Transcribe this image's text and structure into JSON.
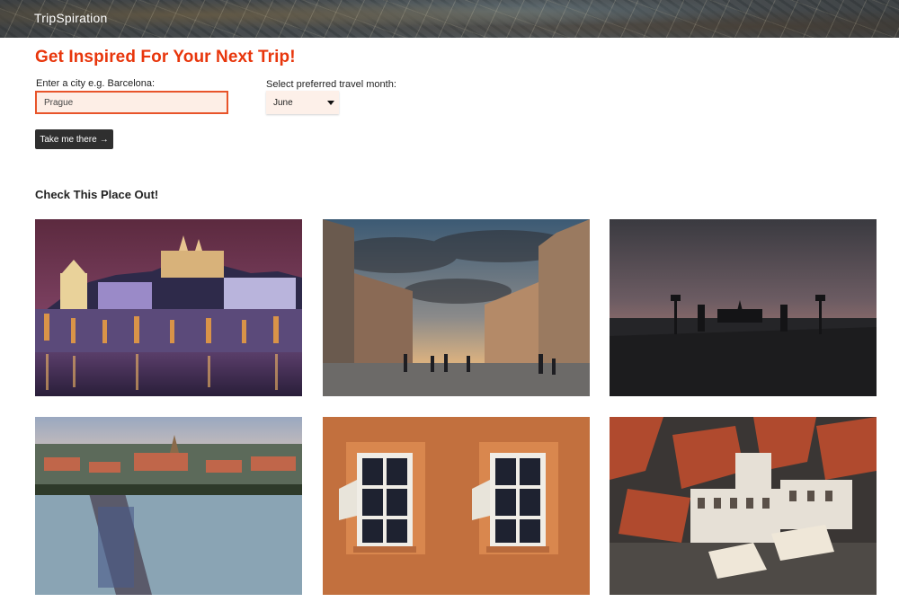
{
  "header": {
    "brand": "TripSpiration"
  },
  "hero": {
    "title": "Get Inspired For Your Next Trip!"
  },
  "form": {
    "city_label": "Enter a city e.g. Barcelona:",
    "city_value": "Prague",
    "month_label": "Select preferred travel month:",
    "month_value": "June",
    "submit_label": "Take me there",
    "submit_arrow": "→"
  },
  "gallery": {
    "title": "Check This Place Out!",
    "photos": [
      {
        "subject": "prague-castle-night"
      },
      {
        "subject": "wenceslas-square-street"
      },
      {
        "subject": "charles-bridge-dusk"
      },
      {
        "subject": "prague-aerial-river"
      },
      {
        "subject": "orange-wall-windows"
      },
      {
        "subject": "old-town-rooftops"
      }
    ]
  },
  "colors": {
    "accent": "#e8360c",
    "input_border": "#e8542a",
    "button_bg": "#2f2f2f"
  }
}
